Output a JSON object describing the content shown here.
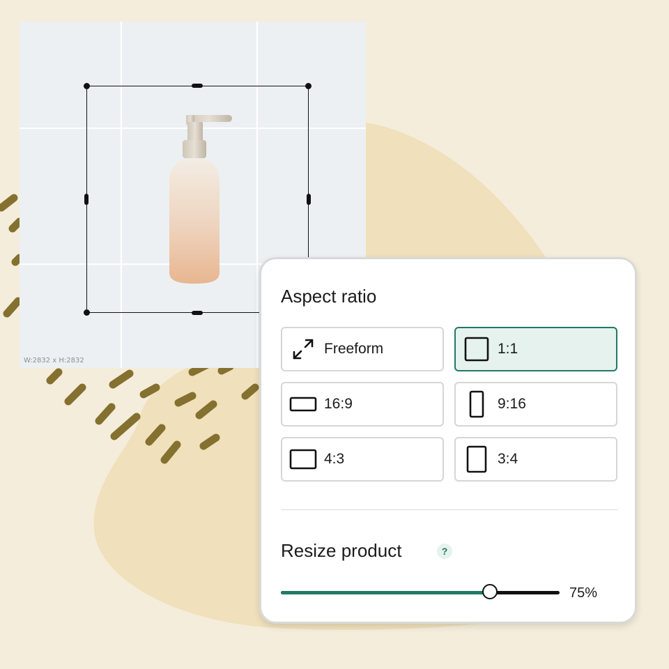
{
  "canvas": {
    "dimensions_label": "W:2832 x H:2832"
  },
  "panel": {
    "aspect_title": "Aspect ratio",
    "ratios": [
      {
        "label": "Freeform",
        "icon": "expand-arrows-icon",
        "selected": false
      },
      {
        "label": "1:1",
        "icon": "square-icon",
        "selected": true
      },
      {
        "label": "16:9",
        "icon": "landscape-wide-icon",
        "selected": false
      },
      {
        "label": "9:16",
        "icon": "portrait-tall-icon",
        "selected": false
      },
      {
        "label": "4:3",
        "icon": "landscape-icon",
        "selected": false
      },
      {
        "label": "3:4",
        "icon": "portrait-icon",
        "selected": false
      }
    ],
    "resize_title": "Resize product",
    "help_label": "?",
    "slider": {
      "value": 75,
      "value_label": "75%"
    }
  },
  "colors": {
    "accent": "#1f7a66",
    "background": "#f5eddb",
    "blob": "#f0e0bb",
    "dash": "#84702f"
  }
}
